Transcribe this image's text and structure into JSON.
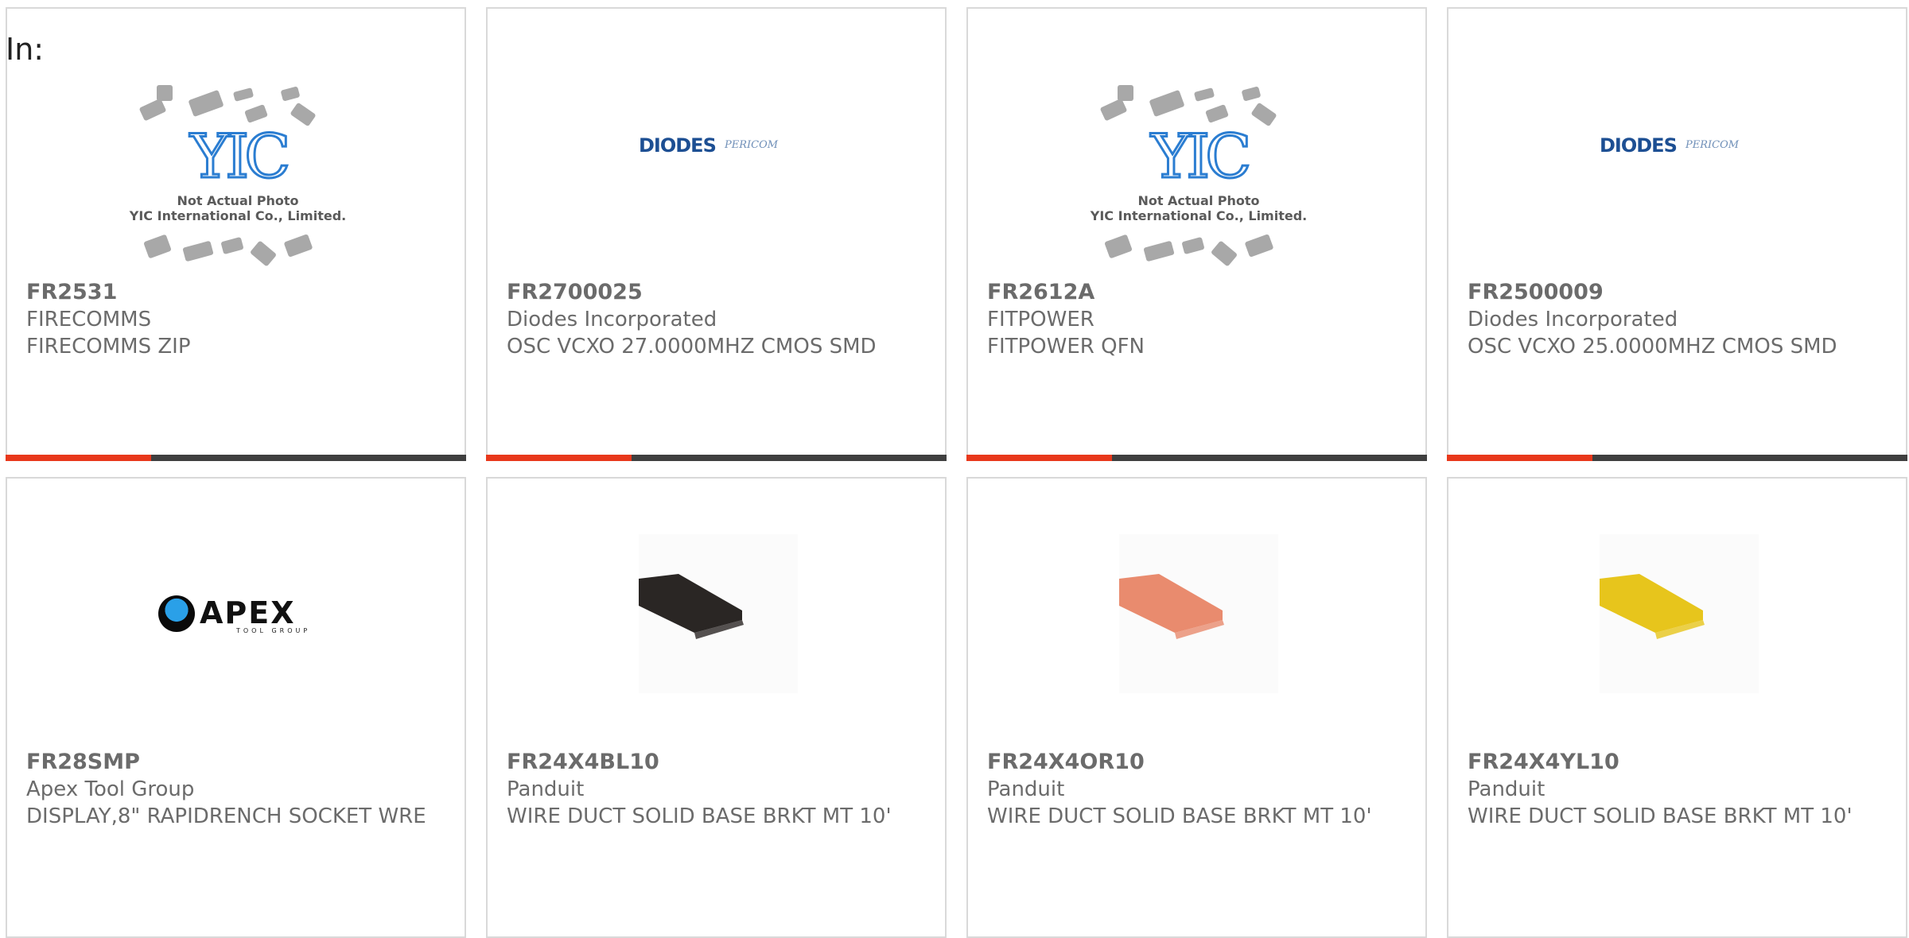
{
  "header": {
    "in_label": "In:"
  },
  "colors": {
    "accent": "#e8381b",
    "bar": "#3f3f3f",
    "border": "#d9d9d9",
    "text": "#6b6b6b"
  },
  "products": [
    {
      "part_number": "FR2531",
      "manufacturer": "FIRECOMMS",
      "description": "FIRECOMMS ZIP",
      "image": "yic-placeholder",
      "image_text": {
        "line1": "Not Actual Photo",
        "line2": "YIC International Co., Limited."
      }
    },
    {
      "part_number": "FR2700025",
      "manufacturer": "Diodes Incorporated",
      "description": "OSC VCXO 27.0000MHZ CMOS SMD",
      "image": "diodes-logo",
      "logo_text": {
        "main": "DIODES",
        "sub": "PERICOM"
      }
    },
    {
      "part_number": "FR2612A",
      "manufacturer": "FITPOWER",
      "description": "FITPOWER QFN",
      "image": "yic-placeholder",
      "image_text": {
        "line1": "Not Actual Photo",
        "line2": "YIC International Co., Limited."
      }
    },
    {
      "part_number": "FR2500009",
      "manufacturer": "Diodes Incorporated",
      "description": "OSC VCXO 25.0000MHZ CMOS SMD",
      "image": "diodes-logo",
      "logo_text": {
        "main": "DIODES",
        "sub": "PERICOM"
      }
    },
    {
      "part_number": "FR28SMP",
      "manufacturer": "Apex Tool Group",
      "description": "DISPLAY,8\" RAPIDRENCH SOCKET WRE",
      "image": "apex-logo",
      "logo_text": {
        "main": "APEX",
        "sub": "TOOL GROUP"
      }
    },
    {
      "part_number": "FR24X4BL10",
      "manufacturer": "Panduit",
      "description": "WIRE DUCT SOLID BASE BRKT MT 10'",
      "image": "wire-duct",
      "duct_color": "#2a2624"
    },
    {
      "part_number": "FR24X4OR10",
      "manufacturer": "Panduit",
      "description": "WIRE DUCT SOLID BASE BRKT MT 10'",
      "image": "wire-duct",
      "duct_color": "#e98b6e"
    },
    {
      "part_number": "FR24X4YL10",
      "manufacturer": "Panduit",
      "description": "WIRE DUCT SOLID BASE BRKT MT 10'",
      "image": "wire-duct",
      "duct_color": "#e7c51c"
    }
  ]
}
